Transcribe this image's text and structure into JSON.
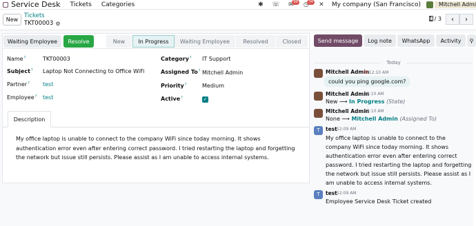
{
  "navbar": {
    "app_name": "Service Desk",
    "menu": [
      "Tickets",
      "Categories"
    ],
    "discuss_badge": "99",
    "activity_badge": "74",
    "company": "My company (San Francisco)",
    "user": "Mitchell Admin"
  },
  "control": {
    "new_label": "New",
    "breadcrumb_parent": "Tickets",
    "breadcrumb_current": "TKT00003",
    "pager": "1 / 3"
  },
  "statusbar": {
    "btn_waiting": "Waiting Employee",
    "btn_resolve": "Resolve",
    "stages": [
      "New",
      "In Progress",
      "Waiting Employee",
      "Resolved",
      "Closed"
    ],
    "active_stage": "In Progress"
  },
  "form": {
    "name_label": "Name",
    "name_value": "TKT00003",
    "subject_label": "Subject",
    "subject_value": "Laptop Not Connecting to Office WiFi",
    "partner_label": "Partner",
    "partner_value": "test",
    "employee_label": "Employee",
    "employee_value": "test",
    "category_label": "Category",
    "category_value": "IT Support",
    "assigned_label": "Assigned To",
    "assigned_value": "Mitchell Admin",
    "priority_label": "Priority",
    "priority_value": "Medium",
    "active_label": "Active",
    "active_value": true,
    "tab_description": "Description",
    "description": "My office laptop is unable to connect to the company WiFi since today morning. It shows authentication error even after entering correct password. I tried restarting the laptop and forgetting the network but issue still persists. Please assist as I am unable to access internal systems."
  },
  "chatter": {
    "buttons": [
      "Send message",
      "Log note",
      "WhatsApp",
      "Activity"
    ],
    "today_label": "Today",
    "messages": [
      {
        "author": "Mitchell Admin",
        "time": "12:10 AM",
        "body": "could you ping google.com?"
      },
      {
        "author": "Mitchell Admin",
        "time": "12:10 AM",
        "old": "New",
        "new": "In Progress",
        "field": "(State)"
      },
      {
        "author": "Mitchell Admin",
        "time": "12:10 AM",
        "old": "None",
        "new": "Mitchell Admin",
        "field": "(Assigned To)"
      },
      {
        "author": "test",
        "time": "12:09 AM",
        "body": "My office laptop is unable to connect to the company WiFi since today morning. It shows authentication error even after entering correct password. I tried restarting the laptop and forgetting the network but issue still persists. Please assist as I am unable to access internal systems."
      },
      {
        "author": "test",
        "time": "12:09 AM",
        "body": "Employee Service Desk Ticket created"
      }
    ]
  }
}
